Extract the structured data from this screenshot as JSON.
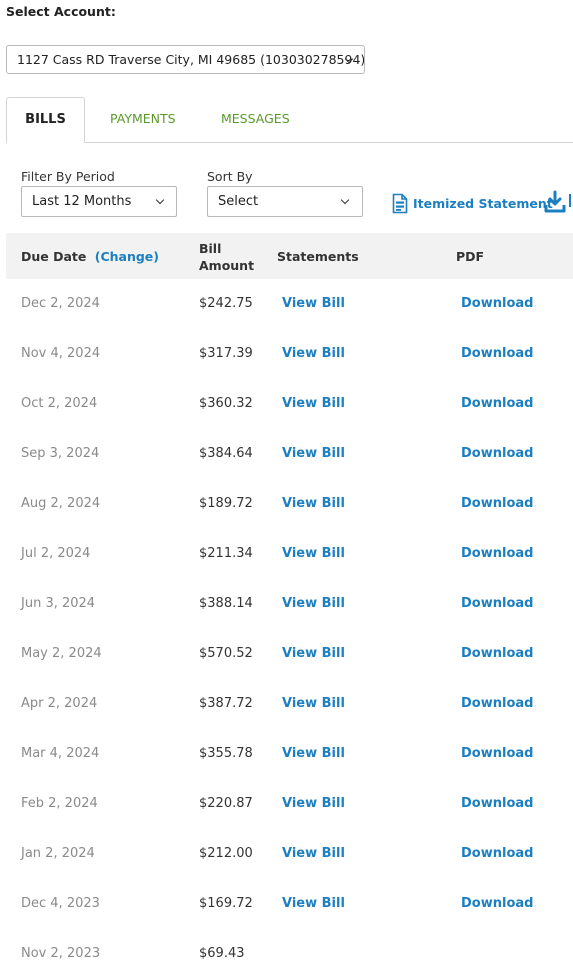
{
  "account": {
    "label": "Select Account:",
    "selected": "1127 Cass RD Traverse City, MI 49685 (103030278594)"
  },
  "tabs": [
    {
      "label": "BILLS",
      "active": true
    },
    {
      "label": "PAYMENTS",
      "active": false
    },
    {
      "label": "MESSAGES",
      "active": false
    }
  ],
  "filters": {
    "period_label": "Filter By Period",
    "period_value": "Last 12 Months",
    "sort_label": "Sort By",
    "sort_value": "Select",
    "itemized_label": "Itemized Statement"
  },
  "table": {
    "headers": {
      "due_date": "Due Date",
      "change": "(Change)",
      "bill_amount_line1": "Bill",
      "bill_amount_line2": "Amount",
      "statements": "Statements",
      "pdf": "PDF"
    },
    "rows": [
      {
        "date": "Dec 2, 2024",
        "amount": "$242.75",
        "view": "View Bill",
        "pdf": "Download"
      },
      {
        "date": "Nov 4, 2024",
        "amount": "$317.39",
        "view": "View Bill",
        "pdf": "Download"
      },
      {
        "date": "Oct 2, 2024",
        "amount": "$360.32",
        "view": "View Bill",
        "pdf": "Download"
      },
      {
        "date": "Sep 3, 2024",
        "amount": "$384.64",
        "view": "View Bill",
        "pdf": "Download"
      },
      {
        "date": "Aug 2, 2024",
        "amount": "$189.72",
        "view": "View Bill",
        "pdf": "Download"
      },
      {
        "date": "Jul 2, 2024",
        "amount": "$211.34",
        "view": "View Bill",
        "pdf": "Download"
      },
      {
        "date": "Jun 3, 2024",
        "amount": "$388.14",
        "view": "View Bill",
        "pdf": "Download"
      },
      {
        "date": "May 2, 2024",
        "amount": "$570.52",
        "view": "View Bill",
        "pdf": "Download"
      },
      {
        "date": "Apr 2, 2024",
        "amount": "$387.72",
        "view": "View Bill",
        "pdf": "Download"
      },
      {
        "date": "Mar 4, 2024",
        "amount": "$355.78",
        "view": "View Bill",
        "pdf": "Download"
      },
      {
        "date": "Feb 2, 2024",
        "amount": "$220.87",
        "view": "View Bill",
        "pdf": "Download"
      },
      {
        "date": "Jan 2, 2024",
        "amount": "$212.00",
        "view": "View Bill",
        "pdf": "Download"
      },
      {
        "date": "Dec 4, 2023",
        "amount": "$169.72",
        "view": "View Bill",
        "pdf": "Download"
      },
      {
        "date": "Nov 2, 2023",
        "amount": "$69.43",
        "view": "",
        "pdf": ""
      }
    ]
  },
  "icons": {
    "statement": "document-icon",
    "download": "download-icon",
    "dropdown": "chevron-down-icon"
  },
  "colors": {
    "link": "#1c7fc2",
    "tab_inactive": "#5a9a2c",
    "header_bg": "#f2f2f2",
    "date_text": "#8a8a8a"
  }
}
